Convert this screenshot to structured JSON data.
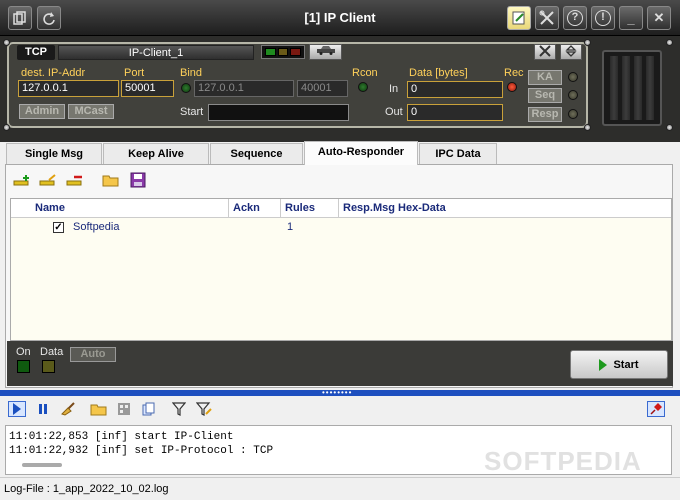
{
  "window": {
    "title": "[1] IP Client"
  },
  "titlebar": {
    "help_glyph": "?",
    "info_glyph": "!",
    "minimize_glyph": "_",
    "close_glyph": "✕"
  },
  "panel": {
    "protocol": "TCP",
    "client_name": "IP-Client_1",
    "dest_label": "dest. IP-Addr",
    "dest_value": "127.0.0.1",
    "port_label": "Port",
    "port_value": "50001",
    "bind_label": "Bind",
    "bind_ip": "127.0.0.1",
    "bind_port": "40001",
    "rcon_label": "Rcon",
    "data_label": "Data [bytes]",
    "rec_label": "Rec",
    "in_label": "In",
    "in_value": "0",
    "out_label": "Out",
    "out_value": "0",
    "start_label": "Start",
    "start_value": "",
    "admin_label": "Admin",
    "mcast_label": "MCast",
    "ka_label": "KA",
    "seq_label": "Seq",
    "resp_label": "Resp"
  },
  "tabs": [
    "Single Msg",
    "Keep Alive",
    "Sequence",
    "Auto-Responder",
    "IPC Data"
  ],
  "active_tab": "Auto-Responder",
  "table": {
    "columns": [
      "Name",
      "Ackn",
      "Rules",
      "Resp.Msg Hex-Data"
    ],
    "rows": [
      {
        "checked": true,
        "check_glyph": "✓",
        "name": "Softpedia",
        "ackn": "",
        "rules": "1",
        "hex": ""
      }
    ]
  },
  "bottom": {
    "on_label": "On",
    "data_label": "Data",
    "auto_label": "Auto",
    "start_button": "Start"
  },
  "log": {
    "lines": [
      "11:01:22,853 [inf] start IP-Client",
      "11:01:22,932 [inf] set IP-Protocol : TCP"
    ]
  },
  "status": {
    "text": "Log-File : 1_app_2022_10_02.log"
  },
  "watermark": "SOFTPEDIA",
  "colors": {
    "accent_gold": "#ffd15a",
    "splitter_blue": "#1e4fbf",
    "panel_dark": "#41413c"
  }
}
